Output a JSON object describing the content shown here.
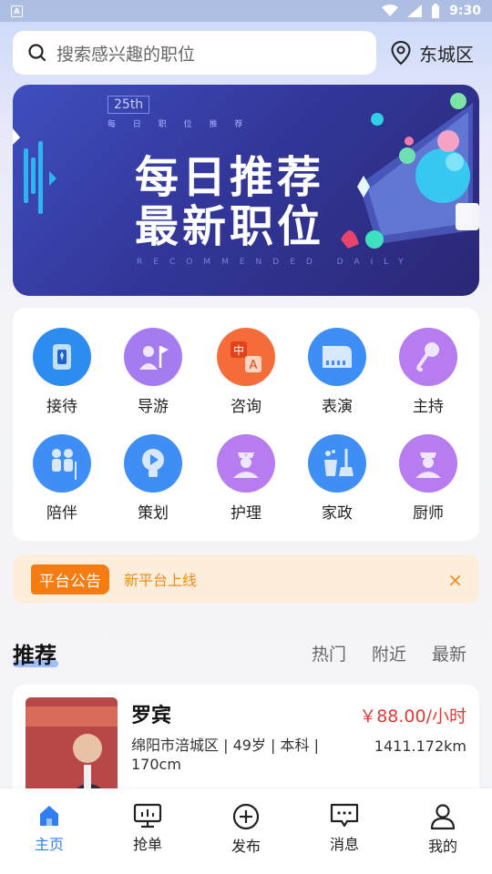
{
  "status_bar": {
    "time": "9:30",
    "app_badge": "A"
  },
  "search": {
    "placeholder": "搜索感兴趣的职位"
  },
  "location": {
    "label": "东城区"
  },
  "banner": {
    "badge": "25th",
    "subtitle": "每 日 职 位 推 荐",
    "line1": "每日推荐",
    "line2": "最新职位",
    "english": "RECOMMENDED DAILY"
  },
  "categories": [
    {
      "label": "接待",
      "icon": "reception-icon",
      "color": "#2d8cf0"
    },
    {
      "label": "导游",
      "icon": "tour-guide-flag-icon",
      "color": "#a57cf0"
    },
    {
      "label": "咨询",
      "icon": "translate-icon",
      "color": "#f56b3a"
    },
    {
      "label": "表演",
      "icon": "piano-icon",
      "color": "#3f8ef5"
    },
    {
      "label": "主持",
      "icon": "microphone-icon",
      "color": "#b77cf0"
    },
    {
      "label": "陪伴",
      "icon": "companion-icon",
      "color": "#3f8ef5"
    },
    {
      "label": "策划",
      "icon": "lightbulb-play-icon",
      "color": "#3f8ef5"
    },
    {
      "label": "护理",
      "icon": "nurse-icon",
      "color": "#b77cf0"
    },
    {
      "label": "家政",
      "icon": "cleaning-icon",
      "color": "#3f8ef5"
    },
    {
      "label": "厨师",
      "icon": "chef-icon",
      "color": "#b77cf0"
    }
  ],
  "notice": {
    "tag": "平台公告",
    "message": "新平台上线",
    "close": "×"
  },
  "recommend": {
    "title": "推荐",
    "tabs": [
      "热门",
      "附近",
      "最新"
    ]
  },
  "person": {
    "name": "罗宾",
    "price": "￥88.00/小时",
    "info": "绵阳市涪城区 | 49岁 | 本科 | 170cm",
    "distance": "1411.172km"
  },
  "nav": [
    {
      "label": "主页",
      "icon": "home-icon",
      "active": true
    },
    {
      "label": "抢单",
      "icon": "monitor-icon",
      "active": false
    },
    {
      "label": "发布",
      "icon": "plus-circle-icon",
      "active": false
    },
    {
      "label": "消息",
      "icon": "message-icon",
      "active": false
    },
    {
      "label": "我的",
      "icon": "user-icon",
      "active": false
    }
  ],
  "colors": {
    "accent": "#2f7ff0",
    "notice_tag": "#f57c12",
    "price": "#e53935"
  }
}
